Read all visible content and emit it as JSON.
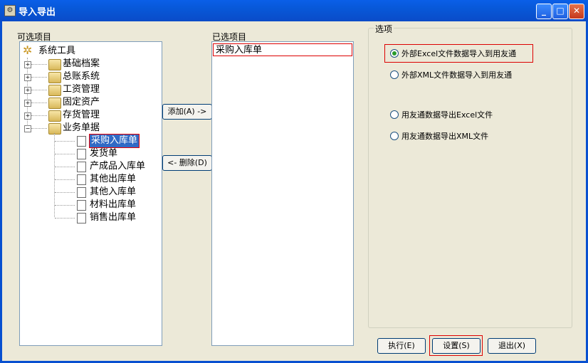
{
  "window": {
    "title": "导入导出"
  },
  "left": {
    "label": "可选项目",
    "root": "系统工具",
    "folders": [
      "基础档案",
      "总账系统",
      "工资管理",
      "固定资产",
      "存货管理",
      "业务单据"
    ],
    "docs": [
      "采购入库单",
      "发货单",
      "产成品入库单",
      "其他出库单",
      "其他入库单",
      "材料出库单",
      "销售出库单"
    ]
  },
  "middle": {
    "add_label": "添加(A) ->",
    "delete_label": "<- 删除(D)"
  },
  "right": {
    "label": "已选项目",
    "items": [
      "采购入库单"
    ]
  },
  "options": {
    "label": "选项",
    "items": [
      {
        "text": "外部Excel文件数据导入到用友通",
        "checked": true
      },
      {
        "text": "外部XML文件数据导入到用友通",
        "checked": false
      },
      {
        "text": "用友通数据导出Excel文件",
        "checked": false
      },
      {
        "text": "用友通数据导出XML文件",
        "checked": false
      }
    ]
  },
  "buttons": {
    "execute": "执行(E)",
    "settings": "设置(S)",
    "exit": "退出(X)"
  }
}
